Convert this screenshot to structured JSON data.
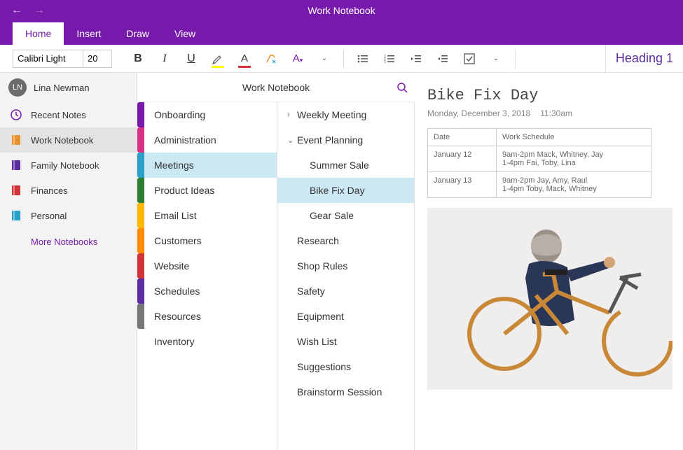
{
  "titlebar": {
    "title": "Work Notebook"
  },
  "tabs": {
    "items": [
      "Home",
      "Insert",
      "Draw",
      "View"
    ],
    "active": "Home"
  },
  "ribbon": {
    "font_name": "Calibri Light",
    "font_size": "20",
    "highlight_color": "#ffff00",
    "font_color": "#d13438",
    "heading_label": "Heading 1"
  },
  "user": {
    "initials": "LN",
    "name": "Lina Newman"
  },
  "sidebar": {
    "items": [
      {
        "icon": "clock-icon",
        "label": "Recent Notes",
        "color": "#7719aa"
      },
      {
        "icon": "notebook-icon",
        "label": "Work Notebook",
        "color": "#e8912d",
        "selected": true
      },
      {
        "icon": "notebook-icon",
        "label": "Family Notebook",
        "color": "#5b2da0"
      },
      {
        "icon": "notebook-icon",
        "label": "Finances",
        "color": "#d13438"
      },
      {
        "icon": "notebook-icon",
        "label": "Personal",
        "color": "#2aa0c8"
      }
    ],
    "more_label": "More Notebooks"
  },
  "section_colors": [
    "#7719aa",
    "#d63384",
    "#2aa0c8",
    "#2e7d32",
    "#ffb900",
    "#ff8c00",
    "#d13438",
    "#5b2da0",
    "#777777"
  ],
  "sections_header": "Work Notebook",
  "sections": [
    {
      "label": "Onboarding"
    },
    {
      "label": "Administration"
    },
    {
      "label": "Meetings",
      "selected": true
    },
    {
      "label": "Product Ideas"
    },
    {
      "label": "Email List"
    },
    {
      "label": "Customers"
    },
    {
      "label": "Website"
    },
    {
      "label": "Schedules"
    },
    {
      "label": "Resources"
    },
    {
      "label": "Inventory"
    }
  ],
  "pages": [
    {
      "label": "Weekly Meeting",
      "chev": "›",
      "indent": 0
    },
    {
      "label": "Event Planning",
      "chev": "⌄",
      "indent": 0
    },
    {
      "label": "Summer Sale",
      "indent": 2
    },
    {
      "label": "Bike Fix Day",
      "indent": 2,
      "selected": true
    },
    {
      "label": "Gear Sale",
      "indent": 2
    },
    {
      "label": "Research",
      "indent": 0
    },
    {
      "label": "Shop Rules",
      "indent": 0
    },
    {
      "label": "Safety",
      "indent": 0
    },
    {
      "label": "Equipment",
      "indent": 0
    },
    {
      "label": "Wish List",
      "indent": 0
    },
    {
      "label": "Suggestions",
      "indent": 0
    },
    {
      "label": "Brainstorm Session",
      "indent": 0
    }
  ],
  "page": {
    "title": "Bike Fix Day",
    "date": "Monday, December 3, 2018",
    "time": "11:30am",
    "table": {
      "headers": [
        "Date",
        "Work Schedule"
      ],
      "rows": [
        [
          "January 12",
          "9am-2pm Mack, Whitney, Jay\n1-4pm Fai, Toby, Lina"
        ],
        [
          "January 13",
          "9am-2pm Jay, Amy, Raul\n1-4pm Toby, Mack, Whitney"
        ]
      ]
    }
  }
}
